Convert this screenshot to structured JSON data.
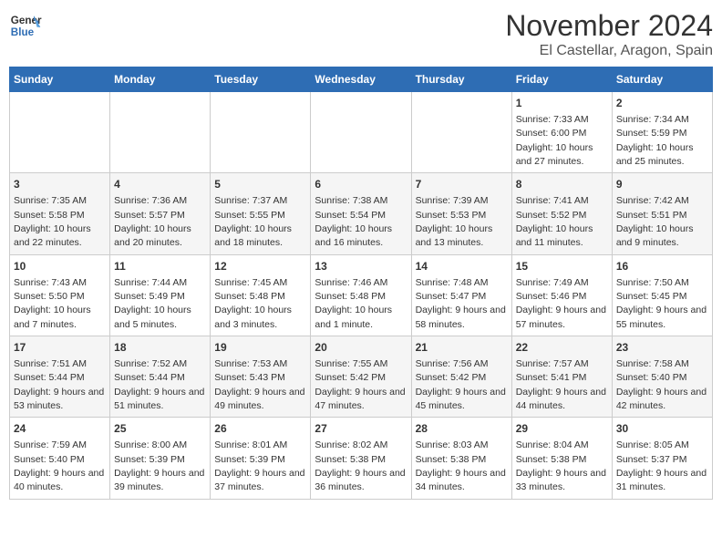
{
  "header": {
    "logo_line1": "General",
    "logo_line2": "Blue",
    "month_year": "November 2024",
    "location": "El Castellar, Aragon, Spain"
  },
  "days_of_week": [
    "Sunday",
    "Monday",
    "Tuesday",
    "Wednesday",
    "Thursday",
    "Friday",
    "Saturday"
  ],
  "weeks": [
    [
      {
        "day": "",
        "info": ""
      },
      {
        "day": "",
        "info": ""
      },
      {
        "day": "",
        "info": ""
      },
      {
        "day": "",
        "info": ""
      },
      {
        "day": "",
        "info": ""
      },
      {
        "day": "1",
        "info": "Sunrise: 7:33 AM\nSunset: 6:00 PM\nDaylight: 10 hours and 27 minutes."
      },
      {
        "day": "2",
        "info": "Sunrise: 7:34 AM\nSunset: 5:59 PM\nDaylight: 10 hours and 25 minutes."
      }
    ],
    [
      {
        "day": "3",
        "info": "Sunrise: 7:35 AM\nSunset: 5:58 PM\nDaylight: 10 hours and 22 minutes."
      },
      {
        "day": "4",
        "info": "Sunrise: 7:36 AM\nSunset: 5:57 PM\nDaylight: 10 hours and 20 minutes."
      },
      {
        "day": "5",
        "info": "Sunrise: 7:37 AM\nSunset: 5:55 PM\nDaylight: 10 hours and 18 minutes."
      },
      {
        "day": "6",
        "info": "Sunrise: 7:38 AM\nSunset: 5:54 PM\nDaylight: 10 hours and 16 minutes."
      },
      {
        "day": "7",
        "info": "Sunrise: 7:39 AM\nSunset: 5:53 PM\nDaylight: 10 hours and 13 minutes."
      },
      {
        "day": "8",
        "info": "Sunrise: 7:41 AM\nSunset: 5:52 PM\nDaylight: 10 hours and 11 minutes."
      },
      {
        "day": "9",
        "info": "Sunrise: 7:42 AM\nSunset: 5:51 PM\nDaylight: 10 hours and 9 minutes."
      }
    ],
    [
      {
        "day": "10",
        "info": "Sunrise: 7:43 AM\nSunset: 5:50 PM\nDaylight: 10 hours and 7 minutes."
      },
      {
        "day": "11",
        "info": "Sunrise: 7:44 AM\nSunset: 5:49 PM\nDaylight: 10 hours and 5 minutes."
      },
      {
        "day": "12",
        "info": "Sunrise: 7:45 AM\nSunset: 5:48 PM\nDaylight: 10 hours and 3 minutes."
      },
      {
        "day": "13",
        "info": "Sunrise: 7:46 AM\nSunset: 5:48 PM\nDaylight: 10 hours and 1 minute."
      },
      {
        "day": "14",
        "info": "Sunrise: 7:48 AM\nSunset: 5:47 PM\nDaylight: 9 hours and 58 minutes."
      },
      {
        "day": "15",
        "info": "Sunrise: 7:49 AM\nSunset: 5:46 PM\nDaylight: 9 hours and 57 minutes."
      },
      {
        "day": "16",
        "info": "Sunrise: 7:50 AM\nSunset: 5:45 PM\nDaylight: 9 hours and 55 minutes."
      }
    ],
    [
      {
        "day": "17",
        "info": "Sunrise: 7:51 AM\nSunset: 5:44 PM\nDaylight: 9 hours and 53 minutes."
      },
      {
        "day": "18",
        "info": "Sunrise: 7:52 AM\nSunset: 5:44 PM\nDaylight: 9 hours and 51 minutes."
      },
      {
        "day": "19",
        "info": "Sunrise: 7:53 AM\nSunset: 5:43 PM\nDaylight: 9 hours and 49 minutes."
      },
      {
        "day": "20",
        "info": "Sunrise: 7:55 AM\nSunset: 5:42 PM\nDaylight: 9 hours and 47 minutes."
      },
      {
        "day": "21",
        "info": "Sunrise: 7:56 AM\nSunset: 5:42 PM\nDaylight: 9 hours and 45 minutes."
      },
      {
        "day": "22",
        "info": "Sunrise: 7:57 AM\nSunset: 5:41 PM\nDaylight: 9 hours and 44 minutes."
      },
      {
        "day": "23",
        "info": "Sunrise: 7:58 AM\nSunset: 5:40 PM\nDaylight: 9 hours and 42 minutes."
      }
    ],
    [
      {
        "day": "24",
        "info": "Sunrise: 7:59 AM\nSunset: 5:40 PM\nDaylight: 9 hours and 40 minutes."
      },
      {
        "day": "25",
        "info": "Sunrise: 8:00 AM\nSunset: 5:39 PM\nDaylight: 9 hours and 39 minutes."
      },
      {
        "day": "26",
        "info": "Sunrise: 8:01 AM\nSunset: 5:39 PM\nDaylight: 9 hours and 37 minutes."
      },
      {
        "day": "27",
        "info": "Sunrise: 8:02 AM\nSunset: 5:38 PM\nDaylight: 9 hours and 36 minutes."
      },
      {
        "day": "28",
        "info": "Sunrise: 8:03 AM\nSunset: 5:38 PM\nDaylight: 9 hours and 34 minutes."
      },
      {
        "day": "29",
        "info": "Sunrise: 8:04 AM\nSunset: 5:38 PM\nDaylight: 9 hours and 33 minutes."
      },
      {
        "day": "30",
        "info": "Sunrise: 8:05 AM\nSunset: 5:37 PM\nDaylight: 9 hours and 31 minutes."
      }
    ]
  ]
}
